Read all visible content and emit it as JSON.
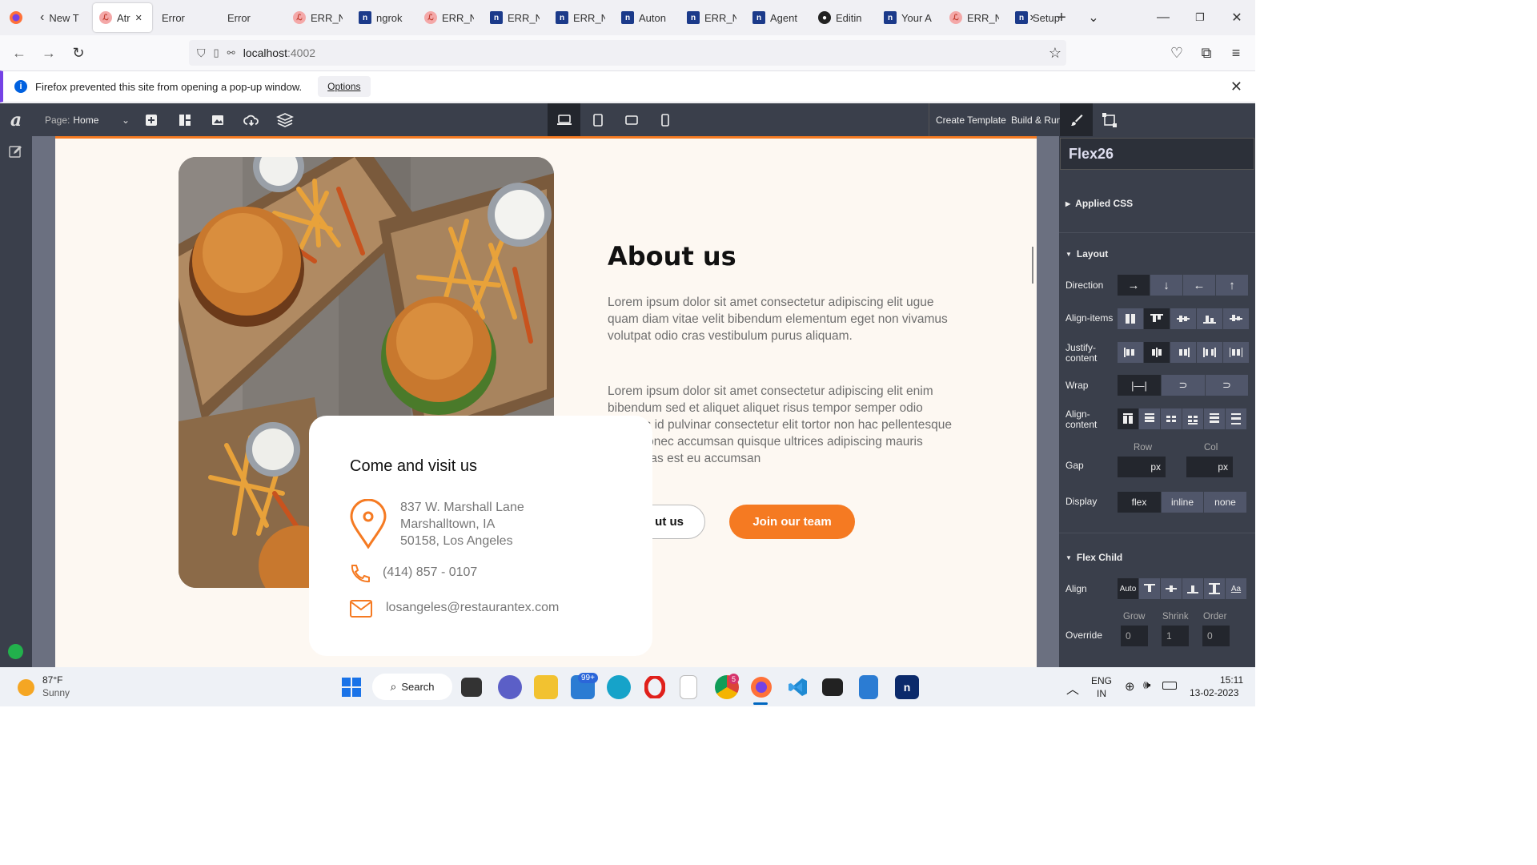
{
  "browser": {
    "tabs": [
      {
        "label": "New T",
        "icon": "back-chevron-icon",
        "kind": "plain"
      },
      {
        "label": "Atr",
        "icon": "error-page-icon",
        "kind": "err",
        "active": true
      },
      {
        "label": "Error",
        "icon": "",
        "kind": "plain"
      },
      {
        "label": "Error",
        "icon": "",
        "kind": "plain"
      },
      {
        "label": "ERR_N",
        "icon": "error-page-icon",
        "kind": "err"
      },
      {
        "label": "ngrok",
        "icon": "n8n-icon",
        "kind": "n"
      },
      {
        "label": "ERR_N",
        "icon": "error-page-icon",
        "kind": "err"
      },
      {
        "label": "ERR_N",
        "icon": "n8n-icon",
        "kind": "n"
      },
      {
        "label": "ERR_N",
        "icon": "n8n-icon",
        "kind": "n"
      },
      {
        "label": "Auton",
        "icon": "n8n-icon",
        "kind": "n"
      },
      {
        "label": "ERR_N",
        "icon": "n8n-icon",
        "kind": "n"
      },
      {
        "label": "Agent",
        "icon": "n8n-icon",
        "kind": "n"
      },
      {
        "label": "Editin",
        "icon": "github-icon",
        "kind": "gh"
      },
      {
        "label": "Your A",
        "icon": "n8n-icon",
        "kind": "n"
      },
      {
        "label": "ERR_N",
        "icon": "error-page-icon",
        "kind": "err"
      },
      {
        "label": "Setup",
        "icon": "n8n-icon",
        "kind": "n"
      }
    ],
    "url_host": "localhost",
    "url_port": ":4002",
    "notification": {
      "text": "Firefox prevented this site from opening a pop-up window.",
      "options_label": "Options"
    }
  },
  "editor": {
    "page_prefix": "Page:",
    "page_name": "Home",
    "create_template": "Create Template",
    "build_run": "Build & Run"
  },
  "canvas": {
    "about_title": "About us",
    "para1": "Lorem ipsum dolor sit amet consectetur adipiscing elit ugue quam diam vitae velit bibendum elementum eget non vivamus volutpat odio cras vestibulum purus aliquam.",
    "para2": "Lorem ipsum dolor sit amet consectetur adipiscing elit enim bibendum sed et aliquet aliquet risus tempor semper odio egestas id pulvinar consectetur elit tortor non hac pellentesque lacus donec accumsan quisque ultrices adipiscing mauris tortor cras est eu accumsan",
    "btn_about": "ut us",
    "btn_join": "Join our team",
    "visit": {
      "title": "Come and visit us",
      "address_lines": [
        "837 W. Marshall Lane",
        "Marshalltown, IA",
        "50158, Los Angeles"
      ],
      "phone": "(414) 857 - 0107",
      "email": "losangeles@restaurantex.com"
    }
  },
  "panel": {
    "title": "Flex26",
    "applied_css": "Applied CSS",
    "layout": "Layout",
    "direction_label": "Direction",
    "direction_options": [
      "→",
      "↓",
      "←",
      "↑"
    ],
    "align_items_label": "Align-items",
    "justify_label_1": "Justify-",
    "justify_label_2": "content",
    "wrap_label": "Wrap",
    "align_content_label_1": "Align-",
    "align_content_label_2": "content",
    "gap_label": "Gap",
    "gap_row": "Row",
    "gap_col": "Col",
    "gap_unit": "px",
    "display_label": "Display",
    "display_options": [
      "flex",
      "inline",
      "none"
    ],
    "flex_child": "Flex Child",
    "align_label": "Align",
    "align_auto": "Auto",
    "override_label": "Override",
    "grow_label": "Grow",
    "shrink_label": "Shrink",
    "order_label": "Order",
    "grow_value": "0",
    "shrink_value": "1",
    "order_value": "0"
  },
  "taskbar": {
    "weather_temp": "87°F",
    "weather_desc": "Sunny",
    "search_label": "Search",
    "mail_badge": "99+",
    "chrome_badge": "5",
    "lang_1": "ENG",
    "lang_2": "IN",
    "time": "15:11",
    "date": "13-02-2023"
  },
  "colors": {
    "accent_orange": "#f57a22",
    "editor_dark": "#3a3f4b",
    "canvas_bg": "#fdf8f2"
  }
}
